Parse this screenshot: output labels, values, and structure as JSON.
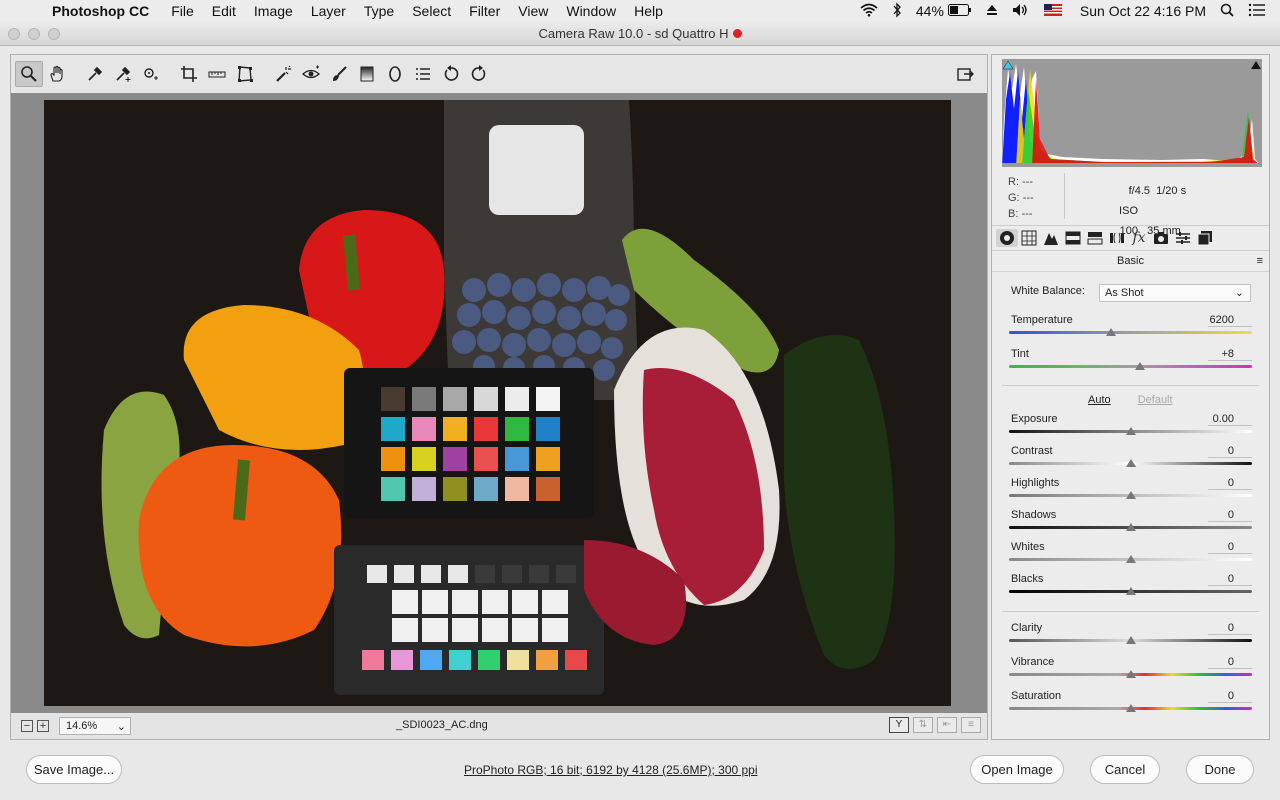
{
  "menubar": {
    "items": [
      "Photoshop CC",
      "File",
      "Edit",
      "Image",
      "Layer",
      "Type",
      "Select",
      "Filter",
      "View",
      "Window",
      "Help"
    ],
    "battery": "44%",
    "datetime": "Sun Oct 22  4:16 PM"
  },
  "window": {
    "title": "Camera Raw 10.0  -  sd Quattro H"
  },
  "toolbar": {
    "tools": [
      "zoom-tool",
      "hand-tool",
      "white-balance-tool",
      "color-sampler-tool",
      "targeted-adjustment-tool",
      "crop-tool",
      "straighten-tool",
      "transform-tool",
      "spot-removal-tool",
      "red-eye-removal-tool",
      "adjustment-brush",
      "graduated-filter",
      "radial-filter",
      "open-preferences",
      "rotate-ccw",
      "rotate-cw"
    ]
  },
  "preview": {
    "zoom": "14.6%",
    "filename": "_SDI0023_AC.dng",
    "view_before_after": "Y"
  },
  "histogram": {
    "rgb_labels": [
      "R:",
      "G:",
      "B:"
    ],
    "rgb_values": [
      "---",
      "---",
      "---"
    ],
    "aperture": "f/4.5",
    "shutter": "1/20 s",
    "iso": "ISO 100",
    "focal": "35 mm"
  },
  "panel": {
    "title": "Basic",
    "wb_label": "White Balance:",
    "wb_value": "As Shot",
    "auto": "Auto",
    "default": "Default",
    "sliders": [
      {
        "label": "Temperature",
        "value": "6200",
        "pos": 0.42
      },
      {
        "label": "Tint",
        "value": "+8",
        "pos": 0.54
      },
      {
        "label": "Exposure",
        "value": "0.00",
        "pos": 0.5
      },
      {
        "label": "Contrast",
        "value": "0",
        "pos": 0.5
      },
      {
        "label": "Highlights",
        "value": "0",
        "pos": 0.5
      },
      {
        "label": "Shadows",
        "value": "0",
        "pos": 0.5
      },
      {
        "label": "Whites",
        "value": "0",
        "pos": 0.5
      },
      {
        "label": "Blacks",
        "value": "0",
        "pos": 0.5
      },
      {
        "label": "Clarity",
        "value": "0",
        "pos": 0.5
      },
      {
        "label": "Vibrance",
        "value": "0",
        "pos": 0.5
      },
      {
        "label": "Saturation",
        "value": "0",
        "pos": 0.5
      }
    ]
  },
  "footer": {
    "save": "Save Image...",
    "workflow": "ProPhoto RGB; 16 bit; 6192 by 4128 (25.6MP); 300 ppi",
    "open": "Open Image",
    "cancel": "Cancel",
    "done": "Done"
  }
}
